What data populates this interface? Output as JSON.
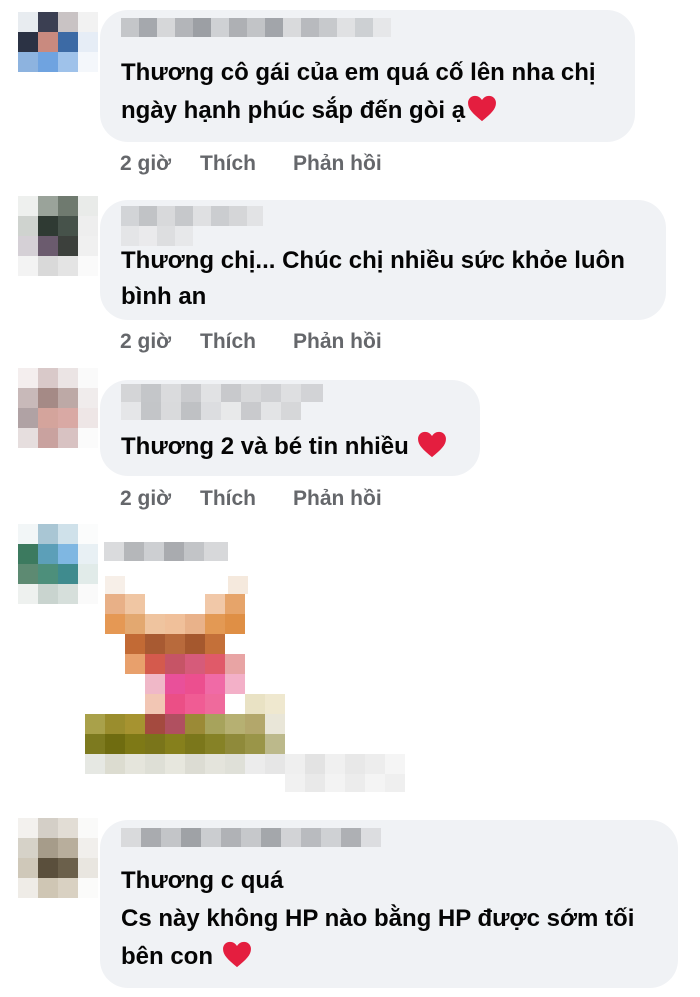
{
  "comments": [
    {
      "lines": [
        "Thương cô gái của em quá cố lên nha chị",
        "ngày hạnh phúc sắp đến gòi ạ"
      ],
      "time": "2 giờ",
      "like_label": "Thích",
      "reply_label": "Phản hồi"
    },
    {
      "lines": [
        "Thương chị... Chúc chị nhiều sức khỏe luôn",
        "bình an"
      ],
      "time": "2 giờ",
      "like_label": "Thích",
      "reply_label": "Phản hồi"
    },
    {
      "lines": [
        "Thương 2 và bé tin nhiều"
      ],
      "time": "2 giờ",
      "like_label": "Thích",
      "reply_label": "Phản hồi"
    },
    {
      "attachment": "sticker-image"
    },
    {
      "lines": [
        "Thương c quá",
        "Cs này không HP nào bằng HP được sớm tối",
        "bên con"
      ]
    }
  ],
  "icons": {
    "reaction": "heart-icon"
  },
  "colors": {
    "bubble": "#f0f2f5",
    "meta_text": "#65676b",
    "heart": "#e41e3f"
  }
}
